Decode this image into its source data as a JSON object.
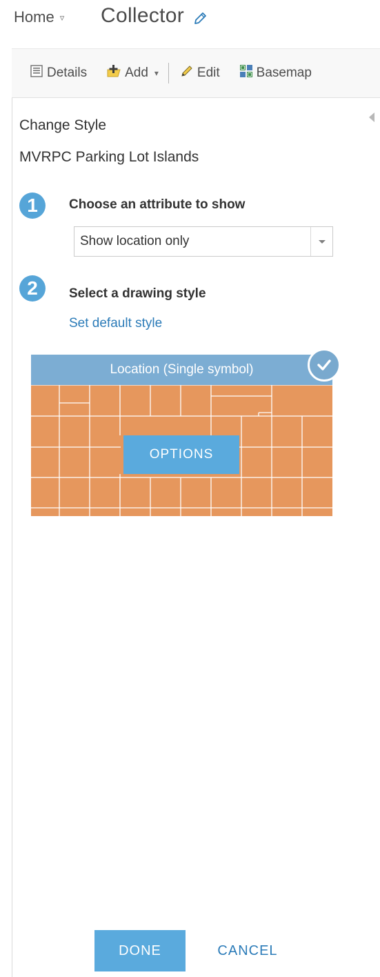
{
  "header": {
    "home_label": "Home",
    "home_caret": "▿",
    "app_title": "Collector"
  },
  "toolbar": {
    "details_label": "Details",
    "add_label": "Add",
    "add_caret": "▾",
    "edit_label": "Edit",
    "basemap_label": "Basemap"
  },
  "panel": {
    "heading": "Change Style",
    "layer_name": "MVRPC Parking Lot Islands",
    "step1": {
      "number": "1",
      "title": "Choose an attribute to show",
      "select_value": "Show location only"
    },
    "step2": {
      "number": "2",
      "title": "Select a drawing style",
      "set_default_link": "Set default style"
    },
    "style_card": {
      "header_label": "Location (Single symbol)",
      "options_label": "OPTIONS",
      "selected": true
    },
    "done_label": "DONE",
    "cancel_label": "CANCEL"
  },
  "colors": {
    "accent": "#5aaadd",
    "link": "#2b7bb8",
    "fill_orange": "#e6975d",
    "card_header": "#7cadd3",
    "marker_red": "#cc2a1f"
  },
  "icons": {
    "pencil": "pencil-icon",
    "details": "details-icon",
    "add": "add-layer-icon",
    "edit": "edit-pencil-icon",
    "basemap": "basemap-grid-icon",
    "collapse": "collapse-arrow-icon",
    "check": "check-icon"
  }
}
